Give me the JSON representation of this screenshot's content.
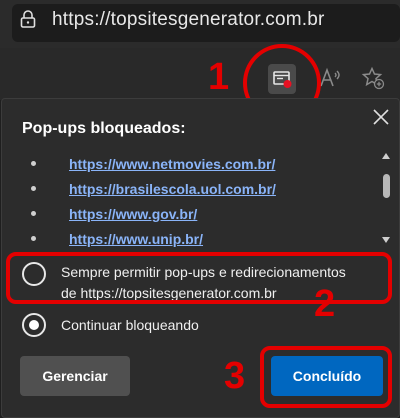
{
  "browser": {
    "url": "https://topsitesgenerator.com.br"
  },
  "toolbar": {
    "icons": [
      "popup-blocked-icon",
      "read-aloud-icon",
      "add-favorite-icon"
    ]
  },
  "annotations": {
    "step1": "1",
    "step2": "2",
    "step3": "3",
    "color": "#e40000"
  },
  "panel": {
    "title": "Pop-ups bloqueados:",
    "blocked_urls": [
      "https://www.netmovies.com.br/",
      "https://brasilescola.uol.com.br/",
      "https://www.gov.br/",
      "https://www.unip.br/"
    ],
    "options": [
      {
        "label_line1": "Sempre permitir pop-ups e redirecionamentos",
        "label_line2": "de https://topsitesgenerator.com.br",
        "selected": false
      },
      {
        "label_line1": "Continuar bloqueando",
        "selected": true
      }
    ],
    "manage_button": "Gerenciar",
    "done_button": "Concluído",
    "accent": "#0067c0"
  }
}
